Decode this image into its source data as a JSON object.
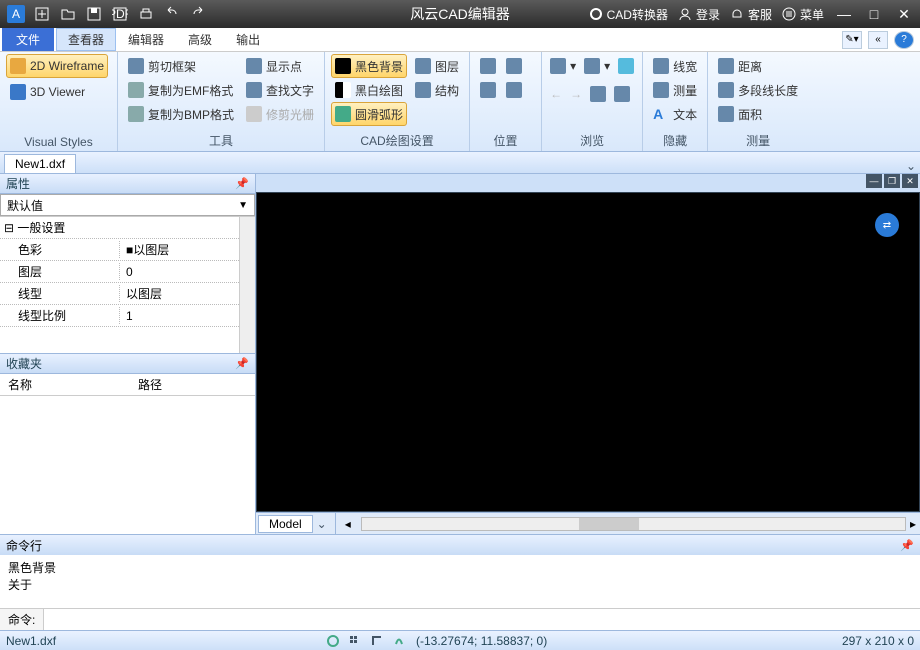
{
  "app": {
    "title": "风云CAD编辑器"
  },
  "titlebar": {
    "converter": "CAD转换器",
    "login": "登录",
    "support": "客服",
    "menu": "菜单"
  },
  "menus": {
    "file": "文件",
    "viewer": "查看器",
    "editor": "编辑器",
    "advanced": "高级",
    "output": "输出"
  },
  "ribbon": {
    "visual_styles": {
      "label": "Visual Styles",
      "wireframe2d": "2D Wireframe",
      "viewer3d": "3D Viewer"
    },
    "tools": {
      "label": "工具",
      "clip_frame": "剪切框架",
      "copy_emf": "复制为EMF格式",
      "copy_bmp": "复制为BMP格式",
      "show_point": "显示点",
      "find_text": "查找文字",
      "trim_raster": "修剪光栅"
    },
    "cad_settings": {
      "label": "CAD绘图设置",
      "black_bg": "黑色背景",
      "bw_draw": "黑白绘图",
      "smooth_arc": "圆滑弧形",
      "layers": "图层",
      "structure": "结构"
    },
    "position": {
      "label": "位置"
    },
    "browse": {
      "label": "浏览"
    },
    "hide": {
      "label": "隐藏",
      "linewidth": "线宽",
      "measure": "测量",
      "text": "文本"
    },
    "measure": {
      "label": "测量",
      "distance": "距离",
      "polyline_len": "多段线长度",
      "area": "面积"
    }
  },
  "filetabs": {
    "tab1": "New1.dxf"
  },
  "props": {
    "title": "属性",
    "default": "默认值",
    "section_general": "一般设置",
    "rows": {
      "color_k": "色彩",
      "color_v": "以图层",
      "layer_k": "图层",
      "layer_v": "0",
      "ltype_k": "线型",
      "ltype_v": "以图层",
      "ltscale_k": "线型比例",
      "ltscale_v": "1"
    }
  },
  "fav": {
    "title": "收藏夹",
    "col_name": "名称",
    "col_path": "路径"
  },
  "canvas": {
    "model_tab": "Model"
  },
  "cmd": {
    "title": "命令行",
    "history_1": "黑色背景",
    "history_2": "关于",
    "prompt": "命令:"
  },
  "status": {
    "file": "New1.dxf",
    "coords": "(-13.27674; 11.58837; 0)",
    "dims": "297 x 210 x 0"
  }
}
